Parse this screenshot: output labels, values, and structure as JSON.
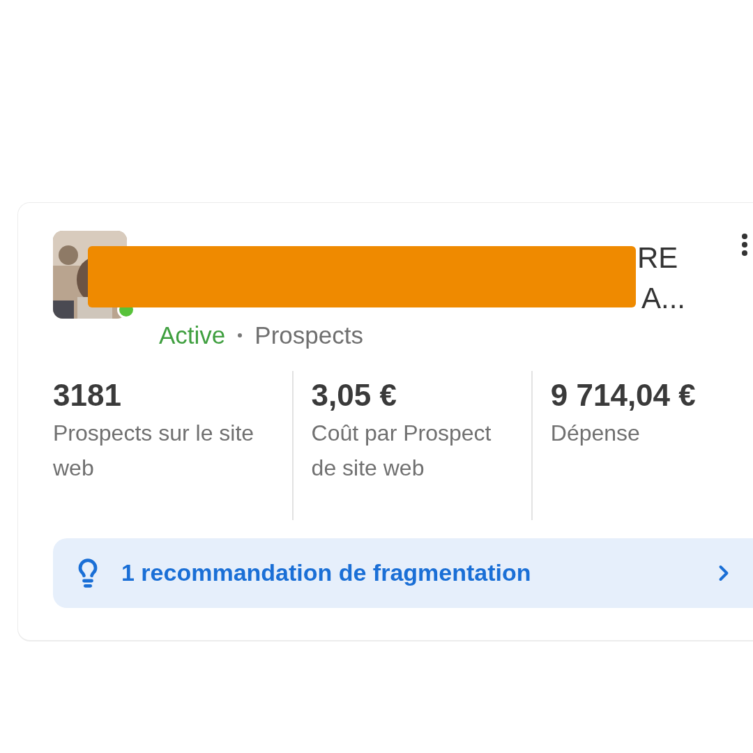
{
  "campaign": {
    "title_end_line_1": "RE",
    "title_end_line_2": "A...",
    "avatar": {
      "kind": "picture",
      "online": true
    },
    "status": {
      "label": "Active",
      "kind": "active"
    },
    "objective": "Prospects"
  },
  "metrics": [
    {
      "value": "3181",
      "label": "Prospects sur le site web"
    },
    {
      "value": "3,05 €",
      "label": "Coût par Prospect de site web"
    },
    {
      "value": "9 714,04 €",
      "label": "Dépense"
    }
  ],
  "recommendation": {
    "text": "1 recommandation de fragmentation"
  }
}
